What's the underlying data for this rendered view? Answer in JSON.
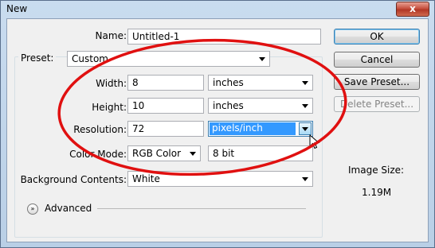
{
  "window": {
    "title": "New",
    "close_glyph": "x"
  },
  "form": {
    "name_label": "Name:",
    "name_value": "Untitled-1",
    "preset_label": "Preset:",
    "preset_value": "Custom",
    "width_label": "Width:",
    "width_value": "8",
    "width_unit": "inches",
    "height_label": "Height:",
    "height_value": "10",
    "height_unit": "inches",
    "resolution_label": "Resolution:",
    "resolution_value": "72",
    "resolution_unit": "pixels/inch",
    "color_mode_label": "Color Mode:",
    "color_mode_value": "RGB Color",
    "bit_depth_value": "8 bit",
    "background_label": "Background Contents:",
    "background_value": "White",
    "advanced_label": "Advanced"
  },
  "buttons": {
    "ok": "OK",
    "cancel": "Cancel",
    "save_preset": "Save Preset...",
    "delete_preset": "Delete Preset..."
  },
  "image_size": {
    "label": "Image Size:",
    "value": "1.19M"
  },
  "colors": {
    "highlight": "#3399ff",
    "annotation": "#e01010",
    "titlebar": "#c9dcef"
  },
  "icons": [
    "close-icon",
    "chevron-down-icon",
    "double-chevron-icon",
    "mouse-cursor-icon"
  ]
}
